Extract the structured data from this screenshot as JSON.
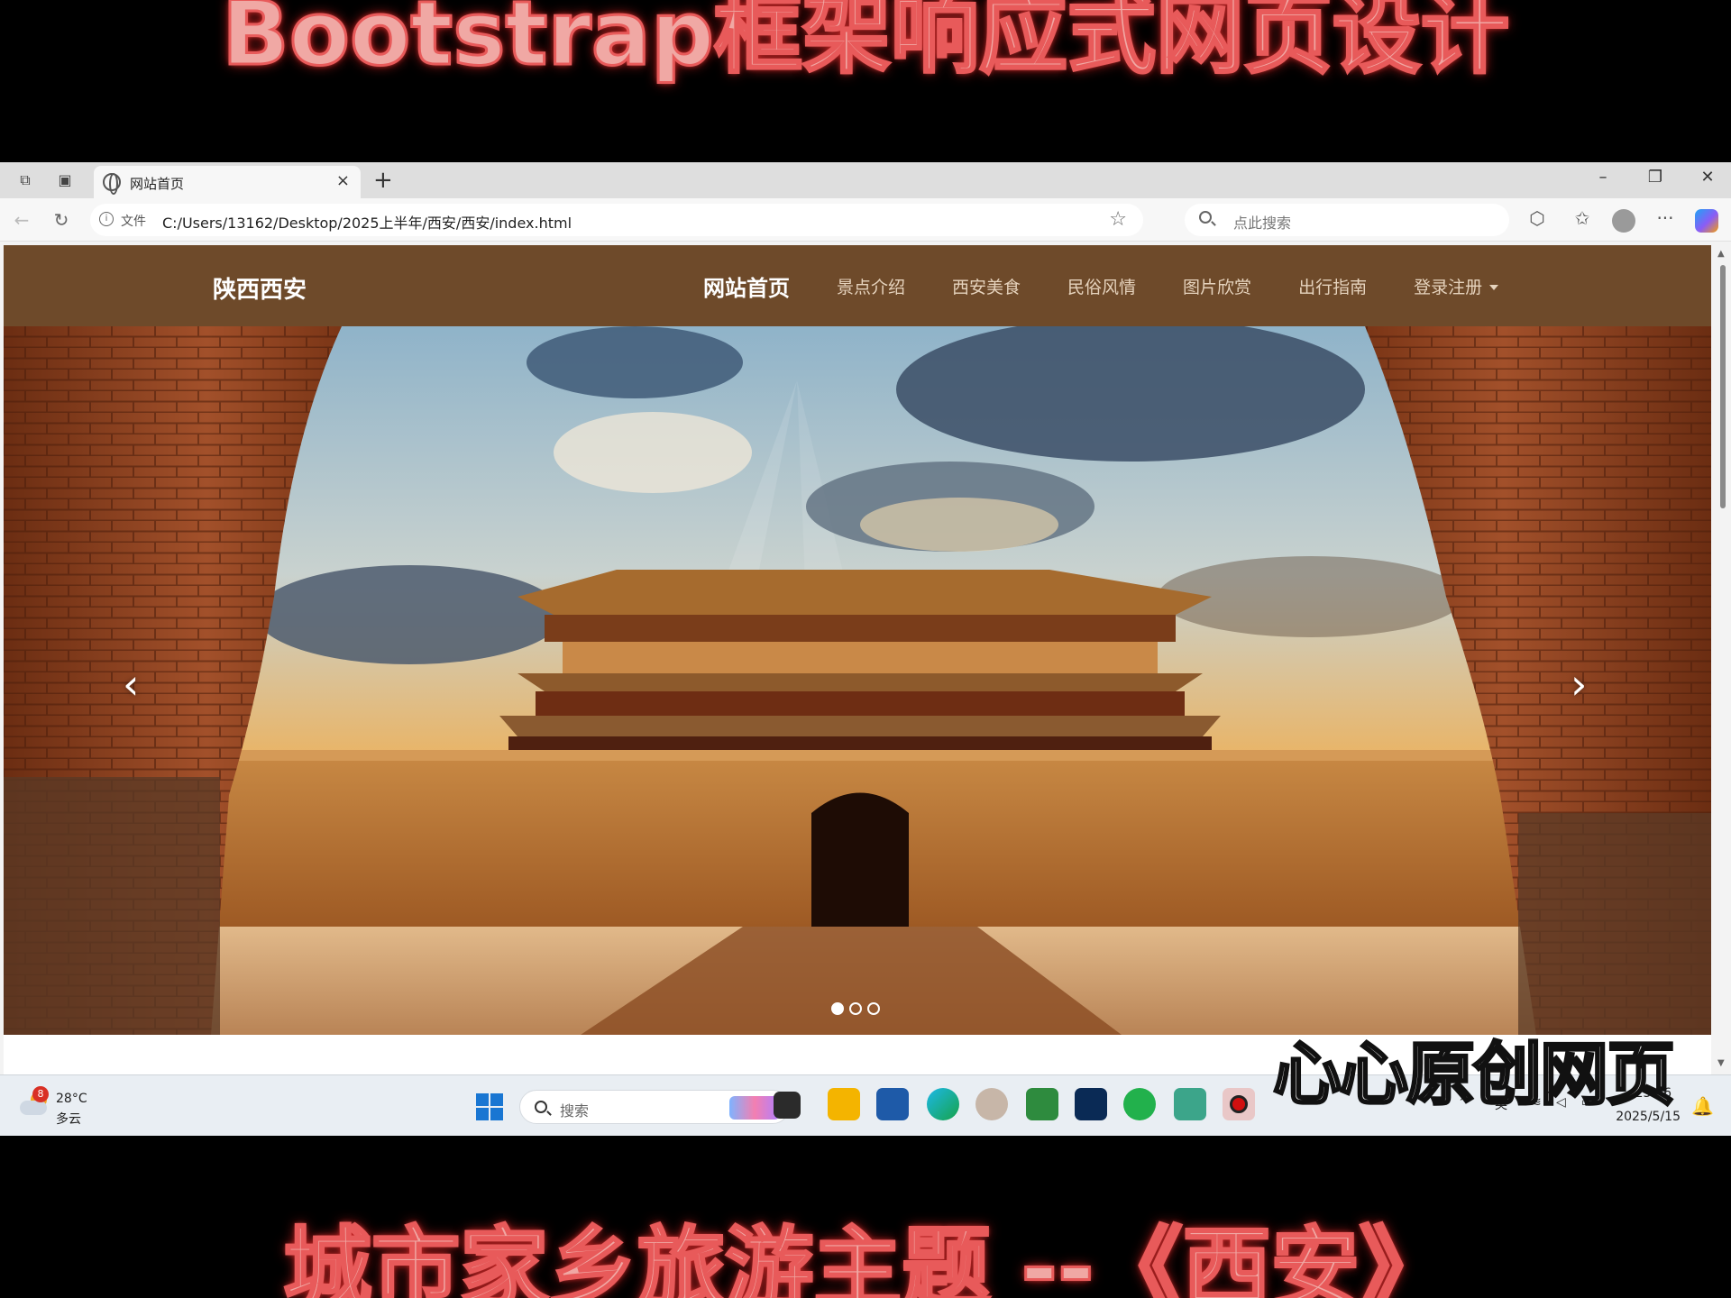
{
  "captions": {
    "top": "Bootstrap框架响应式网页设计",
    "bottom": "城市家乡旅游主题 --《西安》"
  },
  "browser": {
    "tab_title": "网站首页",
    "tab_close": "×",
    "new_tab": "+",
    "window": {
      "minimize": "–",
      "restore": "❐",
      "close": "✕"
    },
    "back": "←",
    "reload": "↻",
    "file_label": "文件",
    "url": "C:/Users/13162/Desktop/2025上半年/西安/西安/index.html",
    "favorite": "☆",
    "search_placeholder": "点此搜索",
    "extensions": "⬡",
    "favorites": "✩",
    "more": "···"
  },
  "site": {
    "brand": "陕西西安",
    "nav": [
      {
        "label": "网站首页",
        "active": true
      },
      {
        "label": "景点介绍"
      },
      {
        "label": "西安美食"
      },
      {
        "label": "民俗风情"
      },
      {
        "label": "图片欣赏"
      },
      {
        "label": "出行指南"
      },
      {
        "label": "登录注册",
        "dropdown": true
      }
    ],
    "carousel": {
      "prev": "‹",
      "next": "›",
      "slide_count": 3,
      "active_slide": 1
    }
  },
  "watermark": "心心原创网页",
  "taskbar": {
    "weather_badge": "8",
    "temperature": "28°C",
    "condition": "多云",
    "search_placeholder": "搜索",
    "tray_caret": "^",
    "ime": "英",
    "wifi": "≋",
    "volume": "◁",
    "battery": "▭",
    "time": "23:46",
    "date": "2025/5/15",
    "bell": "🔔"
  },
  "colors": {
    "navbar": "#6e4a2a",
    "caption_glow": "#e03030"
  }
}
